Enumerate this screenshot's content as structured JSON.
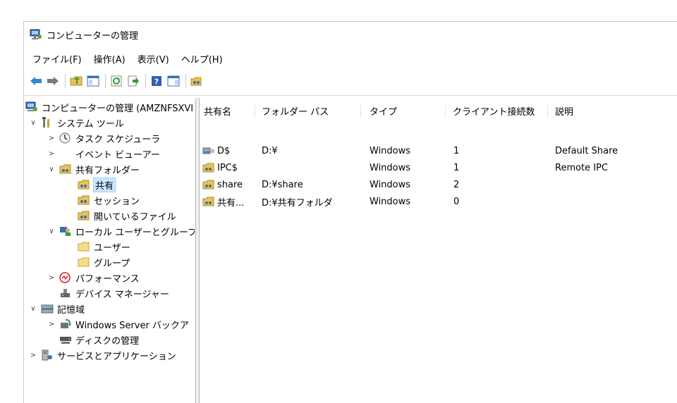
{
  "window": {
    "title": "コンピューターの管理"
  },
  "menu": [
    "ファイル(F)",
    "操作(A)",
    "表示(V)",
    "ヘルプ(H)"
  ],
  "toolbar": [
    "back-icon",
    "forward-icon",
    "up-folder-icon",
    "show-hide-tree-icon",
    "refresh-icon",
    "export-list-icon",
    "help-icon",
    "show-action-pane-icon",
    "new-share-icon"
  ],
  "tree": [
    {
      "label": "コンピューターの管理 (AMZNFSXVI",
      "icon": "computer-management-icon",
      "expander": ""
    },
    {
      "label": "システム ツール",
      "icon": "system-tools-icon",
      "expander": "∨"
    },
    {
      "label": "タスク スケジューラ",
      "icon": "clock-icon",
      "expander": ">"
    },
    {
      "label": "イベント ビューアー",
      "icon": "event-viewer-icon",
      "expander": ">"
    },
    {
      "label": "共有フォルダー",
      "icon": "shared-folder-icon",
      "expander": "∨"
    },
    {
      "label": "共有",
      "icon": "share-icon",
      "expander": ""
    },
    {
      "label": "セッション",
      "icon": "session-icon",
      "expander": ""
    },
    {
      "label": "開いているファイル",
      "icon": "open-files-icon",
      "expander": ""
    },
    {
      "label": "ローカル ユーザーとグループ",
      "icon": "users-groups-icon",
      "expander": "∨"
    },
    {
      "label": "ユーザー",
      "icon": "folder-icon",
      "expander": ""
    },
    {
      "label": "グループ",
      "icon": "folder-icon",
      "expander": ""
    },
    {
      "label": "パフォーマンス",
      "icon": "performance-icon",
      "expander": ">"
    },
    {
      "label": "デバイス マネージャー",
      "icon": "device-manager-icon",
      "expander": ""
    },
    {
      "label": "記憶域",
      "icon": "storage-icon",
      "expander": "∨"
    },
    {
      "label": "Windows Server バックア",
      "icon": "backup-icon",
      "expander": ">"
    },
    {
      "label": "ディスクの管理",
      "icon": "disk-management-icon",
      "expander": ""
    },
    {
      "label": "サービスとアプリケーション",
      "icon": "services-icon",
      "expander": ">"
    }
  ],
  "columns": [
    "共有名",
    "フォルダー パス",
    "タイプ",
    "クライアント接続数",
    "説明"
  ],
  "rows": [
    {
      "name": "D$",
      "path": "D:¥",
      "type": "Windows",
      "clients": "1",
      "desc": "Default Share"
    },
    {
      "name": "IPC$",
      "path": "",
      "type": "Windows",
      "clients": "1",
      "desc": "Remote IPC"
    },
    {
      "name": "share",
      "path": "D:¥share",
      "type": "Windows",
      "clients": "2",
      "desc": ""
    },
    {
      "name": "共有...",
      "path": "D:¥共有フォルダ",
      "type": "Windows",
      "clients": "0",
      "desc": ""
    }
  ]
}
